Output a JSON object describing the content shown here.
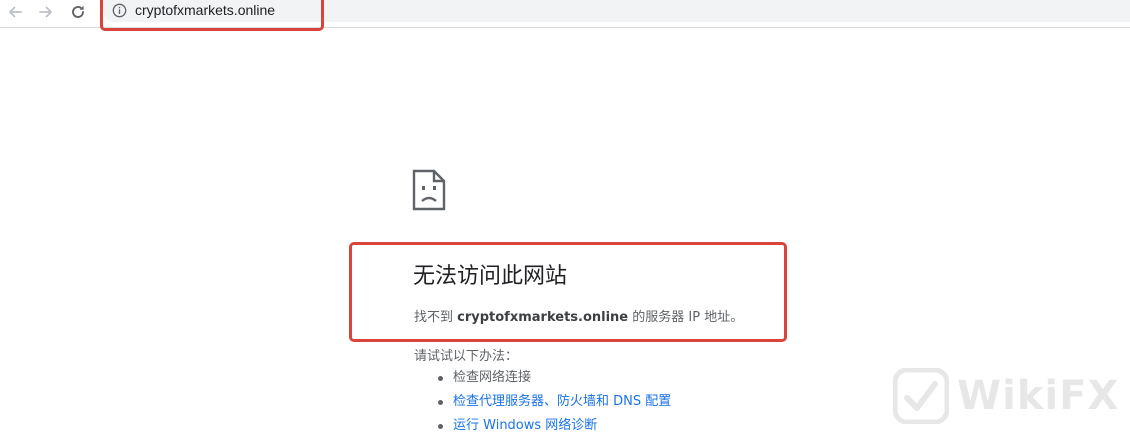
{
  "toolbar": {
    "back_icon": "arrow-left-icon",
    "forward_icon": "arrow-right-icon",
    "reload_icon": "reload-icon",
    "site_info_icon": "info-circle-icon",
    "url": "cryptofxmarkets.online"
  },
  "error": {
    "icon": "sad-document-icon",
    "title": "无法访问此网站",
    "detail_prefix": "找不到 ",
    "detail_host": "cryptofxmarkets.online",
    "detail_suffix": " 的服务器 IP 地址。",
    "suggestion_intro": "请试试以下办法：",
    "suggestions": [
      {
        "label": "检查网络连接",
        "is_link": false
      },
      {
        "label": "检查代理服务器、防火墙和 DNS 配置",
        "is_link": true
      },
      {
        "label": "运行 Windows 网络诊断",
        "is_link": true
      }
    ]
  },
  "watermark": {
    "text": "WikiFX"
  },
  "colors": {
    "annotation": "#d9453d",
    "link": "#1a73e8",
    "text_secondary": "#5f6368",
    "title": "#202124"
  }
}
